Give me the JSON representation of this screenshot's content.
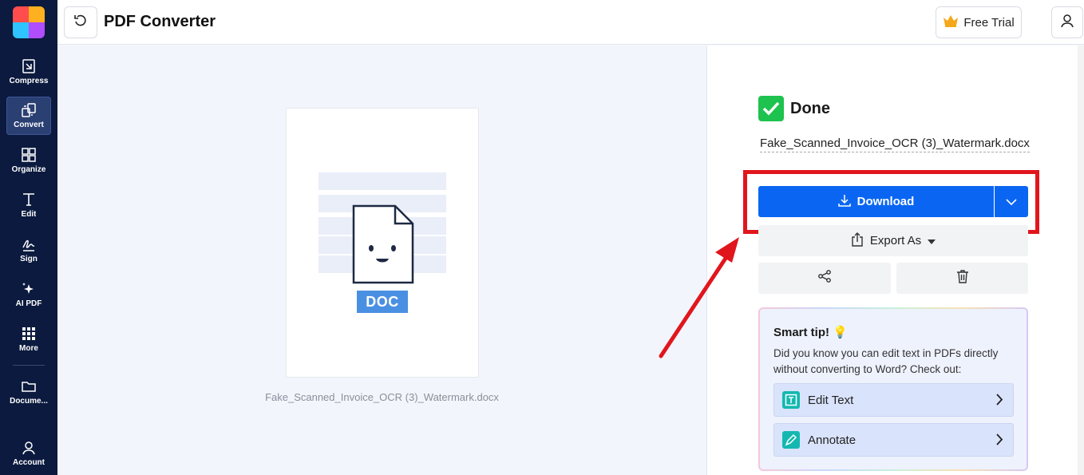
{
  "sidebar": {
    "logo": "app-logo",
    "items": [
      {
        "label": "Compress",
        "icon": "compress-icon"
      },
      {
        "label": "Convert",
        "icon": "convert-icon"
      },
      {
        "label": "Organize",
        "icon": "organize-icon"
      },
      {
        "label": "Edit",
        "icon": "text-edit-icon"
      },
      {
        "label": "Sign",
        "icon": "signature-icon"
      },
      {
        "label": "AI PDF",
        "icon": "sparkle-icon"
      },
      {
        "label": "More",
        "icon": "grid-dots-icon"
      },
      {
        "label": "Docume...",
        "icon": "folder-icon"
      },
      {
        "label": "Account",
        "icon": "user-icon"
      }
    ],
    "active": "Convert"
  },
  "header": {
    "title": "PDF Converter",
    "free_trial_label": "Free Trial"
  },
  "preview": {
    "badge": "DOC",
    "file_caption": "Fake_Scanned_Invoice_OCR (3)_Watermark.docx"
  },
  "panel": {
    "status": "Done",
    "filename": "Fake_Scanned_Invoice_OCR (3)_Watermark.docx",
    "download_label": "Download",
    "export_label": "Export As",
    "tip": {
      "title": "Smart tip!",
      "text": "Did you know you can edit text in PDFs directly without converting to Word? Check out:",
      "actions": [
        {
          "label": "Edit Text",
          "icon": "edit-text-icon"
        },
        {
          "label": "Annotate",
          "icon": "pen-icon"
        }
      ]
    }
  },
  "colors": {
    "sidebar_bg": "#0b1a3e",
    "primary": "#0a66f2",
    "success": "#1ec24e",
    "highlight": "#e1161d",
    "doc_badge": "#4a90e2"
  }
}
